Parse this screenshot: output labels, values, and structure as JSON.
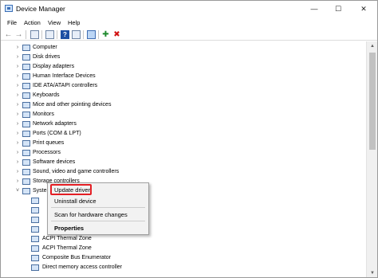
{
  "window": {
    "title": "Device Manager",
    "controls": {
      "minimize": "—",
      "maximize": "☐",
      "close": "✕"
    }
  },
  "menubar": {
    "items": [
      "File",
      "Action",
      "View",
      "Help"
    ]
  },
  "toolbar": {
    "icons": [
      "back-arrow",
      "forward-arrow",
      "properties",
      "update-driver",
      "help",
      "scan-monitor",
      "enable-device",
      "uninstall"
    ],
    "glyphs": {
      "back": "←",
      "forward": "→",
      "help": "?",
      "add": "✚",
      "remove": "✖"
    }
  },
  "tree": {
    "categories": [
      "Computer",
      "Disk drives",
      "Display adapters",
      "Human Interface Devices",
      "IDE ATA/ATAPI controllers",
      "Keyboards",
      "Mice and other pointing devices",
      "Monitors",
      "Network adapters",
      "Ports (COM & LPT)",
      "Print queues",
      "Processors",
      "Software devices",
      "Sound, video and game controllers",
      "Storage controllers",
      "System devices"
    ],
    "system_device_children": [
      "ACPI Thermal Zone",
      "ACPI Thermal Zone",
      "Composite Bus Enumerator",
      "Direct memory access controller"
    ],
    "collapsed_glyph": "›",
    "expanded_glyph": "˅"
  },
  "context_menu": {
    "items": [
      "Update driver",
      "Uninstall device",
      "Scan for hardware changes",
      "Properties"
    ]
  },
  "scrollbar": {
    "up": "▲",
    "down": "▼"
  },
  "colors": {
    "highlight_border": "#e31e24",
    "menu_background": "#f2f2f2"
  }
}
